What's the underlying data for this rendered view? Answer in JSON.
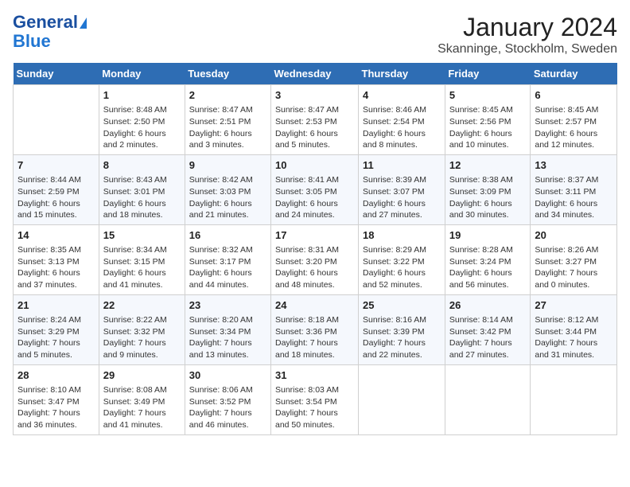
{
  "logo": {
    "line1": "General",
    "line2": "Blue"
  },
  "title": "January 2024",
  "subtitle": "Skanninge, Stockholm, Sweden",
  "days_of_week": [
    "Sunday",
    "Monday",
    "Tuesday",
    "Wednesday",
    "Thursday",
    "Friday",
    "Saturday"
  ],
  "weeks": [
    [
      {
        "day": "",
        "content": ""
      },
      {
        "day": "1",
        "content": "Sunrise: 8:48 AM\nSunset: 2:50 PM\nDaylight: 6 hours\nand 2 minutes."
      },
      {
        "day": "2",
        "content": "Sunrise: 8:47 AM\nSunset: 2:51 PM\nDaylight: 6 hours\nand 3 minutes."
      },
      {
        "day": "3",
        "content": "Sunrise: 8:47 AM\nSunset: 2:53 PM\nDaylight: 6 hours\nand 5 minutes."
      },
      {
        "day": "4",
        "content": "Sunrise: 8:46 AM\nSunset: 2:54 PM\nDaylight: 6 hours\nand 8 minutes."
      },
      {
        "day": "5",
        "content": "Sunrise: 8:45 AM\nSunset: 2:56 PM\nDaylight: 6 hours\nand 10 minutes."
      },
      {
        "day": "6",
        "content": "Sunrise: 8:45 AM\nSunset: 2:57 PM\nDaylight: 6 hours\nand 12 minutes."
      }
    ],
    [
      {
        "day": "7",
        "content": "Sunrise: 8:44 AM\nSunset: 2:59 PM\nDaylight: 6 hours\nand 15 minutes."
      },
      {
        "day": "8",
        "content": "Sunrise: 8:43 AM\nSunset: 3:01 PM\nDaylight: 6 hours\nand 18 minutes."
      },
      {
        "day": "9",
        "content": "Sunrise: 8:42 AM\nSunset: 3:03 PM\nDaylight: 6 hours\nand 21 minutes."
      },
      {
        "day": "10",
        "content": "Sunrise: 8:41 AM\nSunset: 3:05 PM\nDaylight: 6 hours\nand 24 minutes."
      },
      {
        "day": "11",
        "content": "Sunrise: 8:39 AM\nSunset: 3:07 PM\nDaylight: 6 hours\nand 27 minutes."
      },
      {
        "day": "12",
        "content": "Sunrise: 8:38 AM\nSunset: 3:09 PM\nDaylight: 6 hours\nand 30 minutes."
      },
      {
        "day": "13",
        "content": "Sunrise: 8:37 AM\nSunset: 3:11 PM\nDaylight: 6 hours\nand 34 minutes."
      }
    ],
    [
      {
        "day": "14",
        "content": "Sunrise: 8:35 AM\nSunset: 3:13 PM\nDaylight: 6 hours\nand 37 minutes."
      },
      {
        "day": "15",
        "content": "Sunrise: 8:34 AM\nSunset: 3:15 PM\nDaylight: 6 hours\nand 41 minutes."
      },
      {
        "day": "16",
        "content": "Sunrise: 8:32 AM\nSunset: 3:17 PM\nDaylight: 6 hours\nand 44 minutes."
      },
      {
        "day": "17",
        "content": "Sunrise: 8:31 AM\nSunset: 3:20 PM\nDaylight: 6 hours\nand 48 minutes."
      },
      {
        "day": "18",
        "content": "Sunrise: 8:29 AM\nSunset: 3:22 PM\nDaylight: 6 hours\nand 52 minutes."
      },
      {
        "day": "19",
        "content": "Sunrise: 8:28 AM\nSunset: 3:24 PM\nDaylight: 6 hours\nand 56 minutes."
      },
      {
        "day": "20",
        "content": "Sunrise: 8:26 AM\nSunset: 3:27 PM\nDaylight: 7 hours\nand 0 minutes."
      }
    ],
    [
      {
        "day": "21",
        "content": "Sunrise: 8:24 AM\nSunset: 3:29 PM\nDaylight: 7 hours\nand 5 minutes."
      },
      {
        "day": "22",
        "content": "Sunrise: 8:22 AM\nSunset: 3:32 PM\nDaylight: 7 hours\nand 9 minutes."
      },
      {
        "day": "23",
        "content": "Sunrise: 8:20 AM\nSunset: 3:34 PM\nDaylight: 7 hours\nand 13 minutes."
      },
      {
        "day": "24",
        "content": "Sunrise: 8:18 AM\nSunset: 3:36 PM\nDaylight: 7 hours\nand 18 minutes."
      },
      {
        "day": "25",
        "content": "Sunrise: 8:16 AM\nSunset: 3:39 PM\nDaylight: 7 hours\nand 22 minutes."
      },
      {
        "day": "26",
        "content": "Sunrise: 8:14 AM\nSunset: 3:42 PM\nDaylight: 7 hours\nand 27 minutes."
      },
      {
        "day": "27",
        "content": "Sunrise: 8:12 AM\nSunset: 3:44 PM\nDaylight: 7 hours\nand 31 minutes."
      }
    ],
    [
      {
        "day": "28",
        "content": "Sunrise: 8:10 AM\nSunset: 3:47 PM\nDaylight: 7 hours\nand 36 minutes."
      },
      {
        "day": "29",
        "content": "Sunrise: 8:08 AM\nSunset: 3:49 PM\nDaylight: 7 hours\nand 41 minutes."
      },
      {
        "day": "30",
        "content": "Sunrise: 8:06 AM\nSunset: 3:52 PM\nDaylight: 7 hours\nand 46 minutes."
      },
      {
        "day": "31",
        "content": "Sunrise: 8:03 AM\nSunset: 3:54 PM\nDaylight: 7 hours\nand 50 minutes."
      },
      {
        "day": "",
        "content": ""
      },
      {
        "day": "",
        "content": ""
      },
      {
        "day": "",
        "content": ""
      }
    ]
  ]
}
